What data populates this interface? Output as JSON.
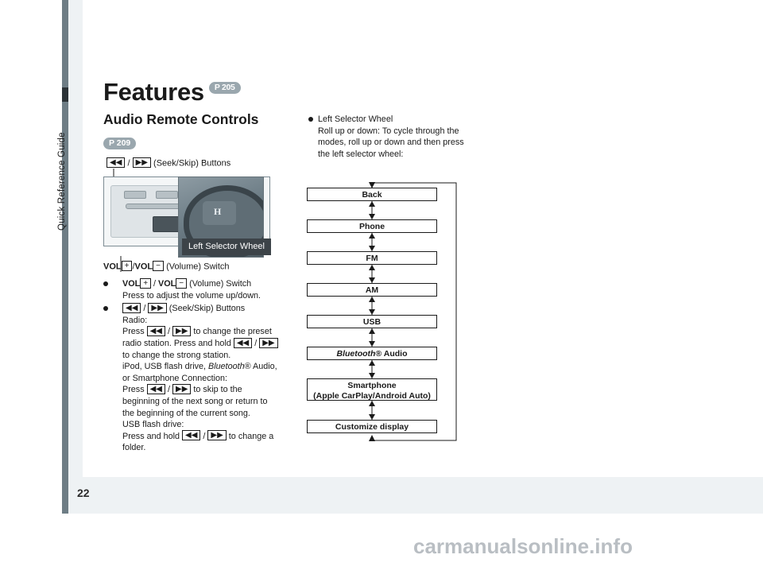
{
  "document": {
    "page_number": "22",
    "section_label": "Quick Reference Guide",
    "watermark": "carmanualsonline.info"
  },
  "headings": {
    "title": "Features",
    "title_ref": "P 205",
    "subtitle": "Audio Remote Controls",
    "subtitle_ref": "P 209"
  },
  "figure": {
    "seek_caption_prefix": "",
    "seek_caption_suffix": "(Seek/Skip) Buttons",
    "seek_icon_prev": "◀◀",
    "seek_icon_next": "▶▶",
    "volume_caption_vol": "VOL",
    "volume_caption_plus": "+",
    "volume_caption_minus": "−",
    "volume_caption_suffix": "(Volume) Switch",
    "left_selector_label": "Left Selector Wheel",
    "steering_logo": "H"
  },
  "left_bullets": [
    {
      "id": "volume-switch",
      "heading_parts": [
        "VOL",
        "+",
        " / ",
        "VOL",
        "−",
        " (Volume) Switch"
      ],
      "lines": [
        "Press to adjust the volume up/down."
      ]
    },
    {
      "id": "seek-skip-buttons",
      "heading_suffix": " (Seek/Skip) Buttons",
      "lines": [
        "Radio:",
        "Press  ◀◀ / ▶▶  to change the preset",
        "radio station. Press and hold  ◀◀ / ▶▶",
        "to change the strong station.",
        "iPod, USB flash drive, Bluetooth® Audio,",
        "or Smartphone Connection:",
        "Press  ◀◀ / ▶▶  to skip to the",
        "beginning of the next song or return to",
        "the beginning of the current song.",
        "USB flash drive:",
        "Press and hold  ◀◀ / ▶▶  to change a",
        "folder."
      ]
    }
  ],
  "right_column": {
    "bullet_title": "Left Selector Wheel",
    "lines": [
      "Roll up or down: To cycle through the",
      "modes, roll up or down and then press",
      "the left selector wheel:"
    ]
  },
  "flow_diagram": {
    "items": [
      {
        "label": "Back",
        "italic": false
      },
      {
        "label": "Phone",
        "italic": false
      },
      {
        "label": "FM",
        "italic": false
      },
      {
        "label": "AM",
        "italic": false
      },
      {
        "label": "USB",
        "italic": false
      },
      {
        "label": "Bluetooth® Audio",
        "italic": true
      },
      {
        "label": "Smartphone\n(Apple CarPlay/Android Auto)",
        "italic": false
      },
      {
        "label": "Customize display",
        "italic": false
      }
    ]
  },
  "colors": {
    "panel_bg": "#eef2f4",
    "side_strip": "#6e7d85",
    "pill_bg": "#9aa7ae",
    "label_bg": "#3c4348",
    "text": "#1a1a1a"
  }
}
